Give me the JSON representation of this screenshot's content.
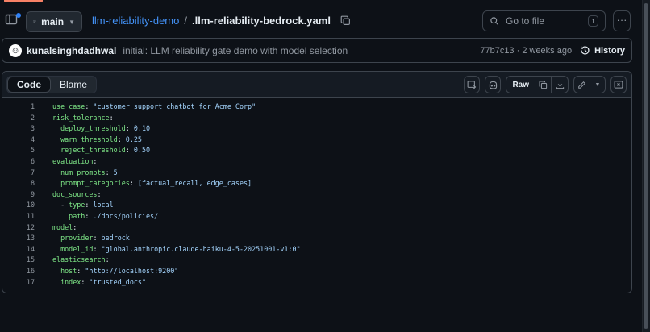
{
  "header": {
    "branch": "main",
    "repo": "llm-reliability-demo",
    "separator": "/",
    "file": ".llm-reliability-bedrock.yaml",
    "goto_placeholder": "Go to file",
    "goto_shortcut": "t"
  },
  "commit": {
    "author": "kunalsinghdadhwal",
    "message": "initial: LLM reliability gate demo with model selection",
    "sha_time": "77b7c13 · 2 weeks ago",
    "history_label": "History"
  },
  "file_view": {
    "tabs": [
      "Code",
      "Blame"
    ],
    "active_tab": "Code",
    "raw_label": "Raw"
  },
  "code_lines": [
    {
      "n": "1",
      "indent": "",
      "key": "use_case",
      "value": "\"customer support chatbot for Acme Corp\""
    },
    {
      "n": "2",
      "indent": "",
      "key": "risk_tolerance",
      "value": ""
    },
    {
      "n": "3",
      "indent": "  ",
      "key": "deploy_threshold",
      "value": "0.10"
    },
    {
      "n": "4",
      "indent": "  ",
      "key": "warn_threshold",
      "value": "0.25"
    },
    {
      "n": "5",
      "indent": "  ",
      "key": "reject_threshold",
      "value": "0.50"
    },
    {
      "n": "6",
      "indent": "",
      "key": "evaluation",
      "value": ""
    },
    {
      "n": "7",
      "indent": "  ",
      "key": "num_prompts",
      "value": "5"
    },
    {
      "n": "8",
      "indent": "  ",
      "key": "prompt_categories",
      "value": "[factual_recall, edge_cases]"
    },
    {
      "n": "9",
      "indent": "",
      "key": "doc_sources",
      "value": ""
    },
    {
      "n": "10",
      "indent": "  - ",
      "key": "type",
      "value": "local"
    },
    {
      "n": "11",
      "indent": "    ",
      "key": "path",
      "value": "./docs/policies/"
    },
    {
      "n": "12",
      "indent": "",
      "key": "model",
      "value": ""
    },
    {
      "n": "13",
      "indent": "  ",
      "key": "provider",
      "value": "bedrock"
    },
    {
      "n": "14",
      "indent": "  ",
      "key": "model_id",
      "value": "\"global.anthropic.claude-haiku-4-5-20251001-v1:0\""
    },
    {
      "n": "15",
      "indent": "",
      "key": "elasticsearch",
      "value": ""
    },
    {
      "n": "16",
      "indent": "  ",
      "key": "host",
      "value": "\"http://localhost:9200\""
    },
    {
      "n": "17",
      "indent": "  ",
      "key": "index",
      "value": "\"trusted_docs\""
    }
  ],
  "colors": {
    "background": "#0d1117",
    "link": "#4493f8",
    "accent": "#f78166",
    "muted": "#9198a1"
  }
}
